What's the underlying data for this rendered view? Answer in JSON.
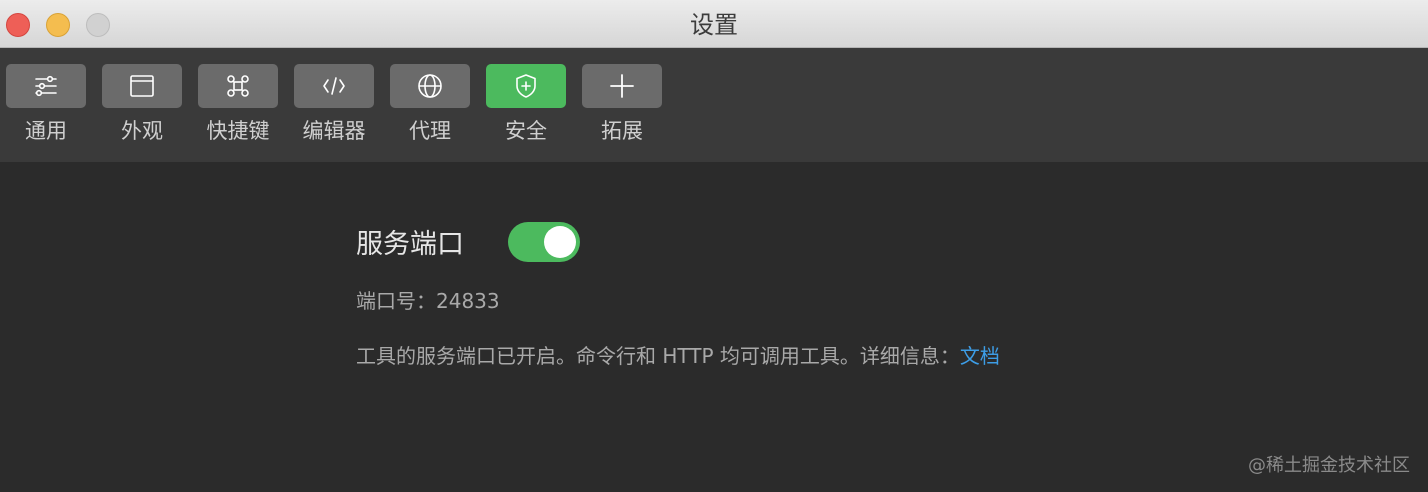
{
  "window": {
    "title": "设置"
  },
  "toolbar": {
    "items": [
      {
        "label": "通用",
        "icon": "sliders-icon",
        "active": false
      },
      {
        "label": "外观",
        "icon": "window-icon",
        "active": false
      },
      {
        "label": "快捷键",
        "icon": "command-key-icon",
        "active": false
      },
      {
        "label": "编辑器",
        "icon": "code-icon",
        "active": false
      },
      {
        "label": "代理",
        "icon": "globe-icon",
        "active": false
      },
      {
        "label": "安全",
        "icon": "shield-plus-icon",
        "active": true
      },
      {
        "label": "拓展",
        "icon": "plus-icon",
        "active": false
      }
    ]
  },
  "service": {
    "label": "服务端口",
    "enabled": true,
    "port_label": "端口号：",
    "port_value": "24833",
    "description": "工具的服务端口已开启。命令行和 HTTP 均可调用工具。详细信息：",
    "doc_link": "文档"
  },
  "watermark": "@稀土掘金技术社区",
  "colors": {
    "accent_green": "#4cba5e",
    "link_blue": "#3d9de6",
    "background": "#2b2b2b",
    "toolbar": "#3a3a3a"
  }
}
